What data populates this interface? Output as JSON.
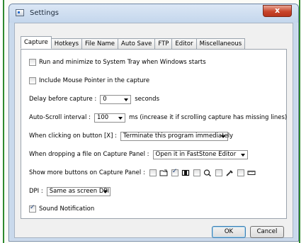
{
  "window": {
    "title": "Settings",
    "close_label": "x"
  },
  "tabs": [
    {
      "label": "Capture",
      "active": true
    },
    {
      "label": "Hotkeys",
      "active": false
    },
    {
      "label": "File Name",
      "active": false
    },
    {
      "label": "Auto Save",
      "active": false
    },
    {
      "label": "FTP",
      "active": false
    },
    {
      "label": "Editor",
      "active": false
    },
    {
      "label": "Miscellaneous",
      "active": false
    }
  ],
  "capture": {
    "run_minimize": {
      "label": "Run and minimize to System Tray when Windows starts",
      "checked": false
    },
    "include_pointer": {
      "label": "Include Mouse Pointer in the capture",
      "checked": false
    },
    "delay": {
      "label": "Delay before capture :",
      "value": "0",
      "suffix": "seconds"
    },
    "autoscroll": {
      "label": "Auto-Scroll interval :",
      "value": "100",
      "suffix": "ms (increase it if scrolling capture has missing lines)"
    },
    "clicking_x": {
      "label": "When clicking on button [X] :",
      "value": "Terminate this program immediately"
    },
    "dropping_file": {
      "label": "When dropping a file on Capture Panel :",
      "value": "Open it in FastStone Editor"
    },
    "more_buttons": {
      "label": "Show more buttons on Capture Panel :",
      "items": [
        {
          "icon": "open-file-icon",
          "checked": false
        },
        {
          "icon": "fixed-region-icon",
          "checked": true
        },
        {
          "icon": "magnifier-icon",
          "checked": false
        },
        {
          "icon": "color-picker-icon",
          "checked": false
        },
        {
          "icon": "screen-ruler-icon",
          "checked": false
        }
      ]
    },
    "dpi": {
      "label": "DPI :",
      "value": "Same as screen DPI"
    },
    "sound": {
      "label": "Sound Notification",
      "checked": true
    }
  },
  "buttons": {
    "ok": "OK",
    "cancel": "Cancel"
  },
  "colors": {
    "frame_accent": "#2f8a2f",
    "close_button": "#c8452b",
    "window_chrome": "#c9d9ec"
  }
}
